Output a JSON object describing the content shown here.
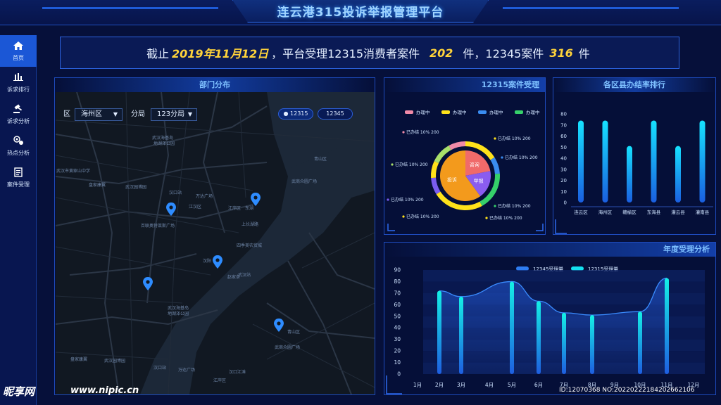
{
  "header": {
    "title": "连云港315投诉举报管理平台"
  },
  "sidebar": {
    "items": [
      {
        "label": "首页",
        "icon": "home-icon",
        "active": true
      },
      {
        "label": "诉求排行",
        "icon": "bar-chart-icon",
        "active": false
      },
      {
        "label": "诉求分析",
        "icon": "gavel-icon",
        "active": false
      },
      {
        "label": "热点分析",
        "icon": "hotspot-icon",
        "active": false
      },
      {
        "label": "案件受理",
        "icon": "document-icon",
        "active": false
      }
    ]
  },
  "summary": {
    "prefix": "截止",
    "date": "2019年11月12日",
    "mid1": "，平台受理12315消费者案件",
    "count_12315": "202",
    "mid2": "件，12345案件",
    "count_12345": "316",
    "suffix": "件"
  },
  "map_panel": {
    "title": "部门分布",
    "district_label": "区",
    "district_value": "海州区",
    "bureau_label": "分局",
    "bureau_value": "123分局",
    "toggle_a": "● 12315",
    "toggle_b": "12345",
    "place_labels": [
      "武汉海基岛",
      "地湖泽公园",
      "武汉市黄家山中学",
      "盘家康翼",
      "武汉园博园",
      "汉口站",
      "万达广场",
      "江汉区",
      "江岸区",
      "百联奥特莱斯广场",
      "东湖",
      "上长湖路",
      "四季美农贸城",
      "青山区",
      "武商众圆广场",
      "汉阳",
      "武汉站",
      "赵家条",
      "武汉海基岛",
      "地湖泽公园",
      "青山区",
      "武商众圆广场",
      "盘家康翼",
      "武汉园博园",
      "汉口站",
      "万达广场",
      "汉口江滩",
      "江岸区"
    ]
  },
  "pie_panel": {
    "title": "12315案件受理",
    "legend": [
      {
        "label": "办理中",
        "color": "#f08aa8"
      },
      {
        "label": "办理中",
        "color": "#ffe21a"
      },
      {
        "label": "办理中",
        "color": "#3a8cf0"
      },
      {
        "label": "办理中",
        "color": "#36d06a"
      }
    ],
    "callouts": [
      "已办结 10% 200",
      "已办结 10% 200",
      "已办结 10% 200",
      "已办结 10% 200",
      "已办结 10% 200",
      "已办结 10% 200",
      "已办结 10% 200",
      "已办结 10% 200"
    ],
    "inner_labels": [
      "咨询",
      "投诉",
      "举报"
    ]
  },
  "bars_panel": {
    "title": "各区县办结率排行"
  },
  "line_panel": {
    "title": "年度受理分析"
  },
  "watermark": {
    "brand": "昵享网",
    "url": "www.nipic.cn",
    "id": "ID:12070368 NO:20220222184202662106"
  },
  "chart_data": [
    {
      "type": "pie",
      "title": "12315案件受理",
      "inner": [
        {
          "label": "投诉",
          "value": 60
        },
        {
          "label": "咨询",
          "value": 22
        },
        {
          "label": "举报",
          "value": 18
        }
      ],
      "outer_ring": [
        {
          "color": "#ffe21a",
          "value": 16
        },
        {
          "color": "#3a8cf0",
          "value": 8
        },
        {
          "color": "#36d06a",
          "value": 18
        },
        {
          "color": "#ffe21a",
          "value": 24
        },
        {
          "color": "#7a5cf0",
          "value": 8
        },
        {
          "color": "#ffe21a",
          "value": 8
        },
        {
          "color": "#a9e06a",
          "value": 10
        },
        {
          "color": "#f08aa8",
          "value": 8
        }
      ]
    },
    {
      "type": "bar",
      "title": "各区县办结率排行",
      "categories": [
        "连云区",
        "海州区",
        "赣榆区",
        "东海县",
        "灌云县",
        "灌南县"
      ],
      "values": [
        74,
        74,
        51,
        74,
        51,
        74
      ],
      "ylim": [
        0,
        80
      ],
      "yticks": [
        0,
        10,
        20,
        30,
        40,
        50,
        60,
        70,
        80
      ]
    },
    {
      "type": "line",
      "title": "年度受理分析",
      "categories": [
        "1月",
        "2月",
        "3月",
        "4月",
        "5月",
        "6月",
        "7月",
        "8月",
        "9月",
        "10月",
        "11月",
        "12月"
      ],
      "series": [
        {
          "name": "12345受理量",
          "values": [
            null,
            72,
            67,
            null,
            80,
            63,
            53,
            51,
            null,
            54,
            83,
            null
          ]
        },
        {
          "name": "12315受理量",
          "values": [
            null,
            72,
            67,
            null,
            80,
            63,
            53,
            51,
            null,
            54,
            83,
            null
          ]
        }
      ],
      "ylim": [
        0,
        90
      ],
      "yticks": [
        0,
        10,
        20,
        30,
        40,
        50,
        60,
        70,
        80,
        90
      ]
    }
  ]
}
